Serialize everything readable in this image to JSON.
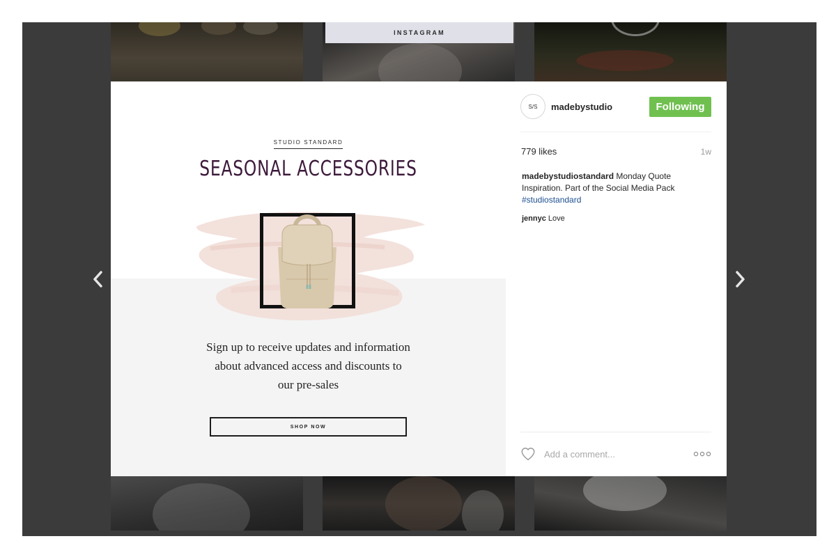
{
  "background": {
    "strip_label": "INSTAGRAM"
  },
  "post": {
    "brand_label": "STUDIO STANDARD",
    "headline": "SEASONAL ACCESSORIES",
    "pitch_lines": [
      "Sign up to receive updates and information",
      "about advanced access and discounts to",
      "our pre-sales"
    ],
    "cta_label": "SHOP NOW"
  },
  "profile": {
    "avatar_text": "S/S",
    "username": "madebystudio",
    "follow_label": "Following"
  },
  "stats": {
    "likes": "779 likes",
    "age": "1w"
  },
  "caption": {
    "user": "madebystudiostandard",
    "text": "Monday Quote Inspiration. Part of the Social Media Pack",
    "hashtag": "#studiostandard"
  },
  "comments": [
    {
      "user": "jennyc",
      "text": "Love"
    }
  ],
  "comment_box": {
    "placeholder": "Add a comment..."
  },
  "icons": {
    "prev": "chevron-left-icon",
    "next": "chevron-right-icon",
    "like": "heart-icon",
    "options": "more-dots-icon"
  },
  "colors": {
    "follow_button": "#70c050",
    "headline": "#3d1a3b",
    "hashtag": "#1d4f91",
    "backdrop": "#3b3b3b"
  }
}
